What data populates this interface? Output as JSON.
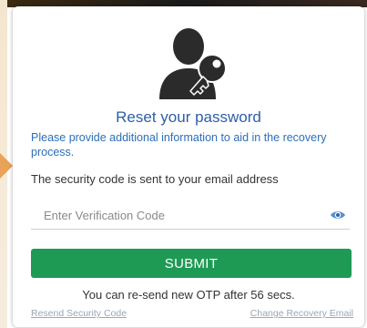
{
  "title": "Reset your password",
  "info_text": "Please provide additional information to aid in the recovery process.",
  "notice_text": "The security code is sent to your email address",
  "verification": {
    "placeholder": "Enter Verification Code",
    "value": ""
  },
  "submit_label": "SUBMIT",
  "resend_message": "You can re-send new OTP after 56 secs.",
  "links": {
    "resend_code": "Resend Security Code",
    "change_email": "Change Recovery Email"
  },
  "icons": {
    "avatar": "user-key-icon",
    "eye": "eye-icon"
  },
  "colors": {
    "title": "#2c5ea8",
    "info": "#2c6fb8",
    "submit": "#1e9a54",
    "link": "#9aa6b8"
  }
}
